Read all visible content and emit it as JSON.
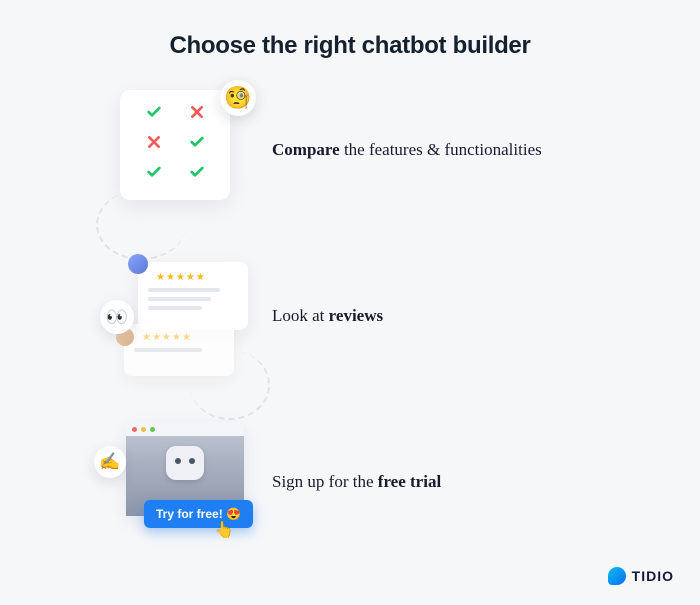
{
  "title": "Choose the right chatbot builder",
  "steps": {
    "compare": {
      "bold": "Compare",
      "rest": " the features & functionalities"
    },
    "reviews": {
      "pre": "Look at ",
      "bold": "reviews"
    },
    "trial": {
      "pre": "Sign up for the ",
      "bold": "free trial"
    }
  },
  "cta": {
    "label": "Try for free! 😍"
  },
  "brand": {
    "name": "TIDIO"
  }
}
